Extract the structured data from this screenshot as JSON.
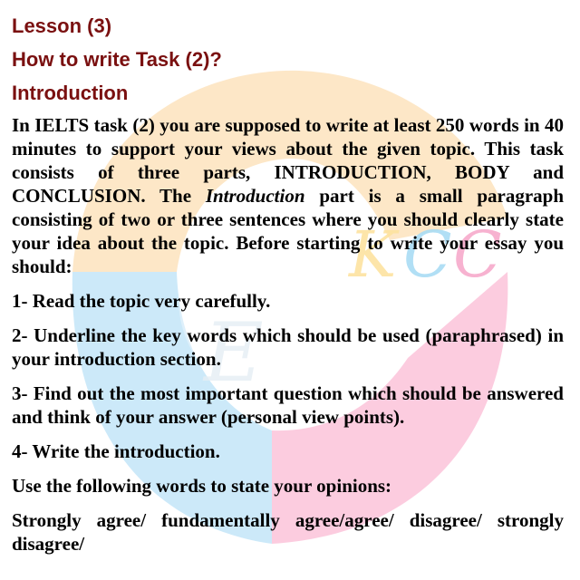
{
  "colors": {
    "heading": "#7a1010",
    "body": "#000000",
    "watermark_orange": "#fcdcae",
    "watermark_blue": "#bfe4f7",
    "watermark_pink": "#fbbfd6"
  },
  "watermark": {
    "icon": "institute-logo-watermark"
  },
  "lesson_title": "Lesson (3)",
  "task_title": "How to write Task (2)?",
  "section_title": "Introduction",
  "intro": {
    "before": "In IELTS task (2) you are supposed to write at least 250 words in 40 minutes to support your views about the given topic. This task consists of three parts, INTRODUCTION, BODY and CONCLUSION. The ",
    "italic": "Introduction",
    "after": " part is a small paragraph consisting of two or three sentences where you should clearly state your idea about the topic. Before starting to write your essay you should:"
  },
  "steps": [
    "1- Read the topic very carefully.",
    "2- Underline the key words which should be used (paraphrased) in your introduction section.",
    "3- Find out the most important question which should be answered and think of your answer (personal view points).",
    "4- Write the introduction."
  ],
  "opinions_intro": "Use the following words to state your opinions:",
  "opinions_list": "Strongly agree/ fundamentally agree/agree/ disagree/ strongly disagree/"
}
